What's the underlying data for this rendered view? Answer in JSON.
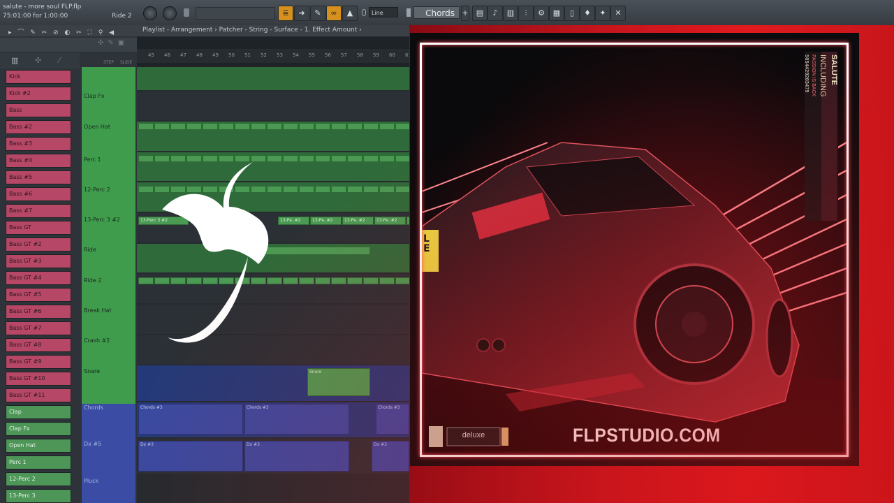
{
  "header": {
    "song_title": "salute - more soul FLP.flp",
    "song_time": "75:01:00 for 1:00:00",
    "pattern_label": "Ride 2",
    "snap": "Line",
    "pattern": "Chords"
  },
  "breadcrumb": "Playlist - Arrangement › Patcher - String - Surface - 1. Effect Amount ›",
  "ruler": {
    "ticks": [
      "45",
      "46",
      "47",
      "48",
      "49",
      "50",
      "51",
      "52",
      "53",
      "54",
      "55",
      "56",
      "57",
      "58",
      "59",
      "60",
      "61"
    ],
    "step_label": "STEP",
    "slide_label": "SLIDE"
  },
  "channels": [
    {
      "label": "Kick",
      "color": "pink"
    },
    {
      "label": "Kick #2",
      "color": "pink"
    },
    {
      "label": "Bass",
      "color": "pink"
    },
    {
      "label": "Bass #2",
      "color": "pink"
    },
    {
      "label": "Bass #3",
      "color": "pink"
    },
    {
      "label": "Bass #4",
      "color": "pink"
    },
    {
      "label": "Bass #5",
      "color": "pink"
    },
    {
      "label": "Bass #6",
      "color": "pink"
    },
    {
      "label": "Bass #7",
      "color": "pink"
    },
    {
      "label": "Bass GT",
      "color": "pink"
    },
    {
      "label": "Bass GT #2",
      "color": "pink"
    },
    {
      "label": "Bass GT #3",
      "color": "pink"
    },
    {
      "label": "Bass GT #4",
      "color": "pink"
    },
    {
      "label": "Bass GT #5",
      "color": "pink"
    },
    {
      "label": "Bass GT #6",
      "color": "pink"
    },
    {
      "label": "Bass GT #7",
      "color": "pink"
    },
    {
      "label": "Bass GT #8",
      "color": "pink"
    },
    {
      "label": "Bass GT #9",
      "color": "pink"
    },
    {
      "label": "Bass GT #10",
      "color": "pink"
    },
    {
      "label": "Bass GT #11",
      "color": "pink"
    },
    {
      "label": "Clap",
      "color": "green"
    },
    {
      "label": "Clap Fx",
      "color": "green"
    },
    {
      "label": "Open Hat",
      "color": "green"
    },
    {
      "label": "Perc 1",
      "color": "green"
    },
    {
      "label": "12-Perc 2",
      "color": "green"
    },
    {
      "label": "13-Perc 3",
      "color": "green"
    }
  ],
  "tracks": [
    {
      "label": "Clap Fx",
      "color": "green"
    },
    {
      "label": "Open Hat",
      "color": "green"
    },
    {
      "label": "Perc 1",
      "color": "green"
    },
    {
      "label": "12-Perc 2",
      "color": "green"
    },
    {
      "label": "13-Perc 3 #2",
      "color": "green"
    },
    {
      "label": "Ride",
      "color": "green"
    },
    {
      "label": "Ride 2",
      "color": "green"
    },
    {
      "label": "Break Hat",
      "color": "green"
    },
    {
      "label": "Crash #2",
      "color": "green"
    },
    {
      "label": "Snare",
      "color": "green"
    },
    {
      "label": "Chords",
      "color": "blue"
    },
    {
      "label": "Dx #5",
      "color": "blue"
    },
    {
      "label": "Pluck",
      "color": "blue"
    }
  ],
  "clips": {
    "perc3": "13-Pe..#2",
    "perc3_first": "13-Perc 3 #2",
    "snare": "Snare",
    "chords": "Chords #3",
    "dx": "Dx #3"
  },
  "cover": {
    "watermark": "FLPSTUDIO.COM",
    "artist": "SALUTE",
    "title": "INCLUDING",
    "subtitle": "PASSION IS BACK",
    "catalog": "5054429203479",
    "label_logo": "deluxe",
    "plate": "L\nE"
  },
  "colors": {
    "accent_red": "#e01a1f",
    "channel_pink": "#b64766",
    "channel_green": "#4d9658",
    "clip_blue": "#3a4aa0"
  },
  "icons": [
    "play-icon",
    "undo-icon",
    "pencil-icon",
    "paint-icon",
    "delete-icon",
    "mute-icon",
    "slice-icon",
    "select-icon",
    "zoom-icon",
    "speaker-icon",
    "mixer-icon",
    "piano-roll-icon",
    "channel-rack-icon",
    "browser-icon",
    "plugin-icon",
    "magnet-icon"
  ]
}
